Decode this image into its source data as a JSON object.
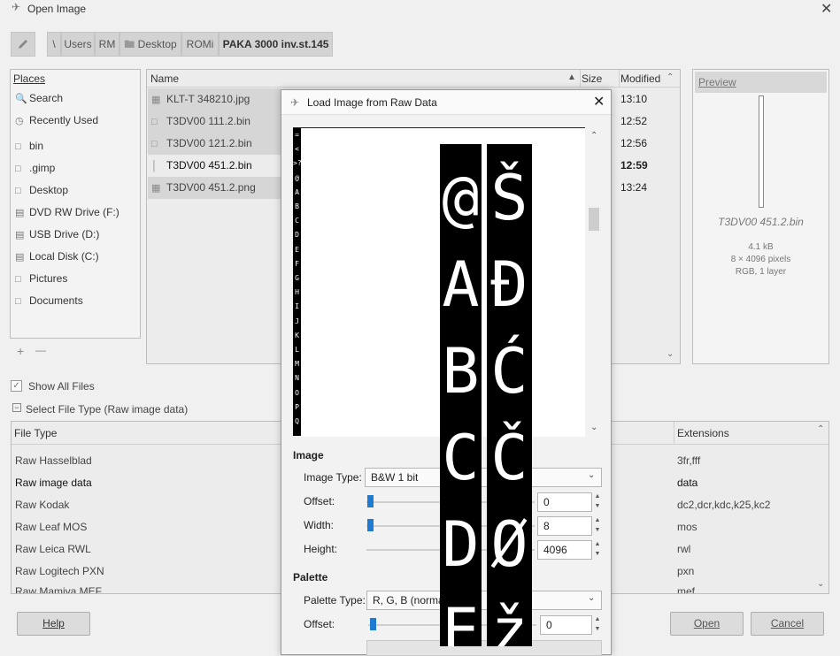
{
  "title": "Open Image",
  "path": [
    "\\",
    "Users",
    "RM",
    "Desktop",
    "ROMi",
    "PAKA 3000 inv.st.145"
  ],
  "places": {
    "header": "Places",
    "items": [
      {
        "label": "Search",
        "icon": "search-icon"
      },
      {
        "label": "Recently Used",
        "icon": "clock-icon"
      },
      {
        "label": "bin",
        "icon": "folder-icon"
      },
      {
        "label": ".gimp",
        "icon": "folder-icon"
      },
      {
        "label": "Desktop",
        "icon": "folder-icon"
      },
      {
        "label": "DVD RW Drive (F:)",
        "icon": "drive-icon"
      },
      {
        "label": "USB Drive (D:)",
        "icon": "drive-icon"
      },
      {
        "label": "Local Disk (C:)",
        "icon": "drive-icon"
      },
      {
        "label": "Pictures",
        "icon": "folder-icon"
      },
      {
        "label": "Documents",
        "icon": "folder-icon"
      }
    ],
    "add": "+",
    "remove": "—"
  },
  "files": {
    "columns": {
      "name": "Name",
      "size": "Size",
      "modified": "Modified"
    },
    "rows": [
      {
        "name": "KLT-T 348210.jpg",
        "modified": "13:10"
      },
      {
        "name": "T3DV00 111.2.bin",
        "modified": "12:52"
      },
      {
        "name": "T3DV00 121.2.bin",
        "modified": "12:56"
      },
      {
        "name": "T3DV00 451.2.bin",
        "modified": "12:59"
      },
      {
        "name": "T3DV00 451.2.png",
        "modified": "13:24"
      }
    ]
  },
  "preview": {
    "header": "Preview",
    "filename": "T3DV00 451.2.bin",
    "size": "4.1 kB",
    "dims": "8 × 4096 pixels",
    "mode": "RGB, 1 layer"
  },
  "show_all": "Show All Files",
  "select_type": "Select File Type (Raw image data)",
  "filetypes": {
    "col_type": "File Type",
    "col_ext": "Extensions",
    "rows": [
      {
        "type": "Raw Hasselblad",
        "ext": "3fr,fff"
      },
      {
        "type": "Raw image data",
        "ext": "data"
      },
      {
        "type": "Raw Kodak",
        "ext": "dc2,dcr,kdc,k25,kc2"
      },
      {
        "type": "Raw Leaf MOS",
        "ext": "mos"
      },
      {
        "type": "Raw Leica RWL",
        "ext": "rwl"
      },
      {
        "type": "Raw Logitech PXN",
        "ext": "pxn"
      },
      {
        "type": "Raw Mamiya MEF",
        "ext": "mef"
      }
    ]
  },
  "buttons": {
    "help": "Help",
    "open": "Open",
    "cancel": "Cancel"
  },
  "raw_dialog": {
    "title": "Load Image from Raw Data",
    "image_section": "Image",
    "image_type_label": "Image Type:",
    "image_type": "B&W 1 bit",
    "offset_label": "Offset:",
    "offset": "0",
    "width_label": "Width:",
    "width": "8",
    "height_label": "Height:",
    "height": "4096",
    "palette_section": "Palette",
    "palette_type_label": "Palette Type:",
    "palette_type": "R, G, B (norma",
    "palette_offset_label": "Offset:",
    "palette_offset": "0"
  },
  "glyphs": {
    "left": [
      "@",
      "A",
      "B",
      "C",
      "D",
      "E"
    ],
    "right": [
      "Š",
      "Đ",
      "Ć",
      "Č",
      "Ø",
      "ž"
    ],
    "strip": "=<>?@ABCDEFGHIJKLMNOPQ"
  }
}
